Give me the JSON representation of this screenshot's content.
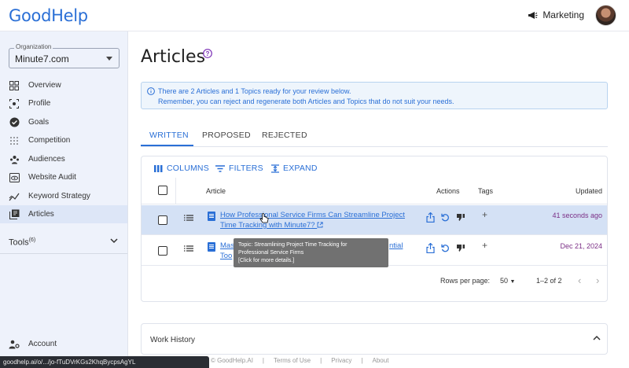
{
  "header": {
    "logo": "GoodHelp",
    "workspace": "Marketing"
  },
  "sidebar": {
    "org_label": "Organization",
    "org_value": "Minute7.com",
    "items": [
      {
        "label": "Overview",
        "icon": "grid-icon"
      },
      {
        "label": "Profile",
        "icon": "profile-icon"
      },
      {
        "label": "Goals",
        "icon": "check-circle-icon"
      },
      {
        "label": "Competition",
        "icon": "dots-icon"
      },
      {
        "label": "Audiences",
        "icon": "audience-icon"
      },
      {
        "label": "Website Audit",
        "icon": "eye-icon"
      },
      {
        "label": "Keyword Strategy",
        "icon": "chart-icon"
      },
      {
        "label": "Articles",
        "icon": "articles-icon"
      }
    ],
    "tools_label": "Tools",
    "tools_count": "(6)",
    "account_label": "Account"
  },
  "main": {
    "title": "Articles",
    "info_line1": "There are 2 Articles and 1 Topics ready for your review below.",
    "info_line2": "Remember, you can reject and regenerate both Articles and Topics that do not suit your needs.",
    "tabs": [
      "WRITTEN",
      "PROPOSED",
      "REJECTED"
    ],
    "toolbar": {
      "columns": "COLUMNS",
      "filters": "FILTERS",
      "expand": "EXPAND"
    },
    "columns": {
      "article": "Article",
      "actions": "Actions",
      "tags": "Tags",
      "updated": "Updated"
    },
    "rows": [
      {
        "title1": "How Professional Service Firms Can Streamline Project",
        "title2": "Time Tracking with Minute7",
        "updated": "41 seconds ago"
      },
      {
        "title1": "Mas",
        "title2": "Too",
        "title1_tail": "ntial",
        "updated": "Dec 21, 2024"
      }
    ],
    "footer": {
      "rows_label": "Rows per page:",
      "rows_value": "50",
      "range": "1–2 of 2"
    },
    "tooltip": {
      "line1": "Topic: Streamlining Project Time Tracking for",
      "line2": "Professional Service Firms",
      "line3": "[Click for more details.]"
    },
    "work_history": "Work History"
  },
  "footer_links": [
    "© GoodHelp.AI",
    "|",
    "Terms of Use",
    "|",
    "Privacy",
    "|",
    "About"
  ],
  "status_url": "goodhelp.ai/o/.../jo-fTuDVrKGs2KhqBycpsAgYL",
  "colors": {
    "accent": "#2a6fd6",
    "date": "#7b2f86",
    "selected_row": "#d4e1f5"
  }
}
